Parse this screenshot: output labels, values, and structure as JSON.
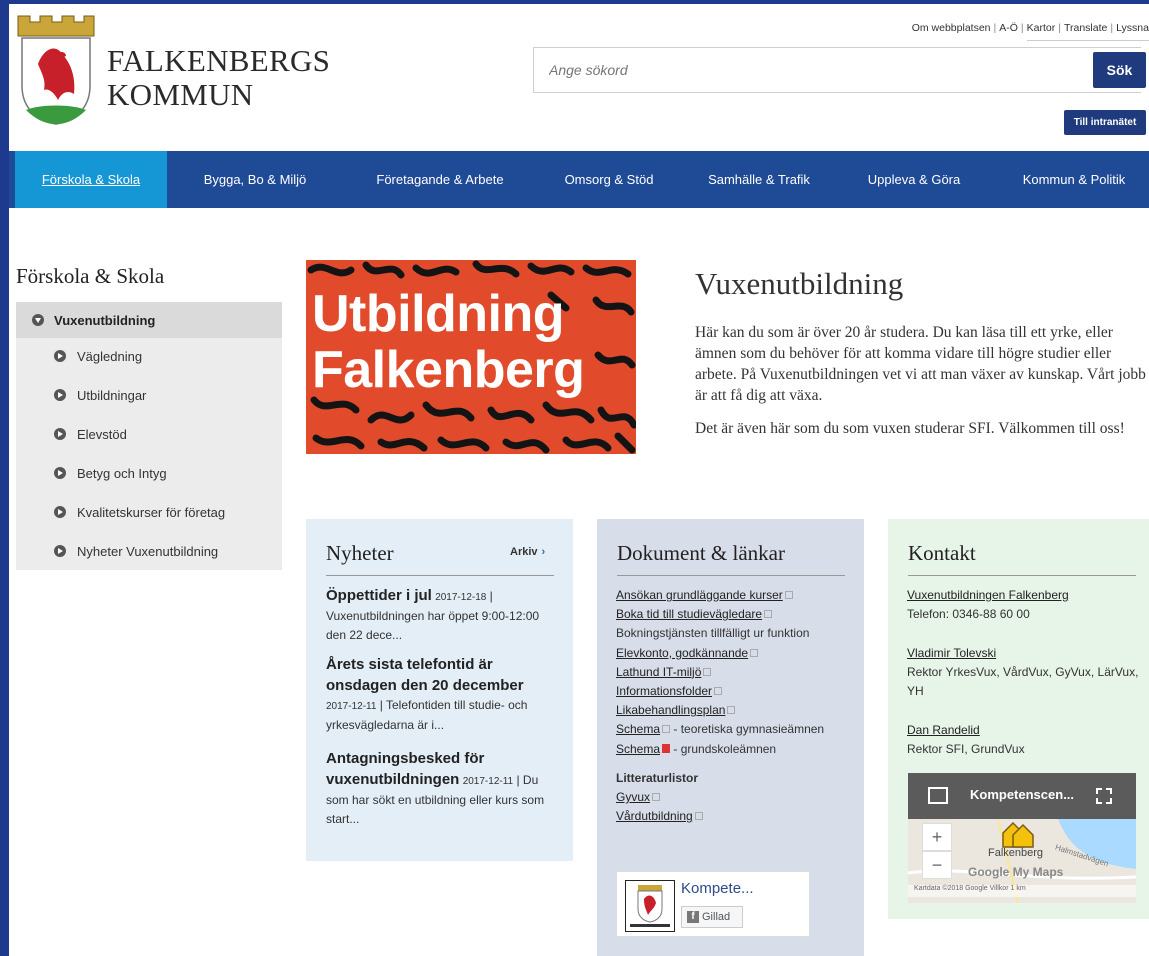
{
  "header": {
    "brand_line1": "FALKENBERGS",
    "brand_line2": "KOMMUN",
    "toplinks": [
      "Om webbplatsen",
      "A-Ö",
      "Kartor",
      "Translate",
      "Lyssna"
    ],
    "search_placeholder": "Ange sökord",
    "search_button": "Sök",
    "intranet_button": "Till intranätet"
  },
  "nav": {
    "items": [
      "Förskola & Skola",
      "Bygga, Bo & Miljö",
      "Företagande & Arbete",
      "Omsorg & Stöd",
      "Samhälle & Trafik",
      "Uppleva & Göra",
      "Kommun & Politik"
    ],
    "active": "Förskola & Skola"
  },
  "sidebar": {
    "title": "Förskola & Skola",
    "current": "Vuxenutbildning",
    "items": [
      "Vägledning",
      "Utbildningar",
      "Elevstöd",
      "Betyg och Intyg",
      "Kvalitetskurser för företag",
      "Nyheter Vuxenutbildning"
    ]
  },
  "hero": {
    "line1": "Utbildning",
    "line2": "Falkenberg"
  },
  "main": {
    "heading": "Vuxenutbildning",
    "para1": "Här kan du som är över 20 år studera. Du kan läsa till ett yrke, eller ämnen som du behöver för att komma vidare till högre studier eller arbete. På Vuxenutbildningen vet vi att man växer av kunskap. Vårt jobb är att få dig att växa.",
    "para2": "Det är även här som du som vuxen studerar SFI. Välkommen till oss!"
  },
  "news": {
    "title": "Nyheter",
    "archive": "Arkiv",
    "items": [
      {
        "title": "Öppettider i jul",
        "date": "2017-12-18",
        "text": "Vuxenutbildningen har öppet 9:00-12:00 den 22 dece..."
      },
      {
        "title": "Årets sista telefontid är onsdagen den 20 december",
        "date": "2017-12-11",
        "text": "Telefontiden till studie- och yrkesvägledarna är i..."
      },
      {
        "title": "Antagningsbesked för vuxenutbildningen",
        "date": "2017-12-11",
        "text": "Du som har sökt en utbildning eller kurs som start..."
      }
    ]
  },
  "docs": {
    "title": "Dokument & länkar",
    "links": {
      "l1": "Ansökan grundläggande kurser",
      "l2": "Boka tid till studievägledare",
      "l2_note": "Bokningstjänsten tillfälligt ur funktion",
      "l3": "Elevkonto, godkännande",
      "l4": "Lathund IT-miljö",
      "l5": "Informationsfolder",
      "l6": "Likabehandlingsplan",
      "l7": "Schema",
      "l7_note": " - teoretiska gymnasieämnen",
      "l8": "Schema",
      "l8_note": " - grundskoleämnen"
    },
    "lit_title": "Litteraturlistor",
    "lit1": "Gyvux",
    "lit2": "Vårdutbildning",
    "fb_name": "Kompete...",
    "fb_like": "Gillad"
  },
  "contact": {
    "title": "Kontakt",
    "org": "Vuxenutbildningen Falkenberg",
    "phone": "Telefon: 0346-88 60 00",
    "p1_name": "Vladimir Tolevski",
    "p1_role": "Rektor YrkesVux, VårdVux, GyVux, LärVux, YH",
    "p2_name": "Dan Randelid",
    "p2_role": "Rektor SFI, GrundVux",
    "map_title": "Kompetenscen...",
    "map_place": "Falkenberg",
    "map_road": "Halmstadvägen",
    "map_brand": "Google My Maps",
    "map_footer": "Kartdata ©2018 Google   Villkor   1 km"
  },
  "colors": {
    "nav": "#1f4a96",
    "nav_active": "#1597d6",
    "hero": "#e14b2c",
    "button": "#1f3a7d"
  }
}
